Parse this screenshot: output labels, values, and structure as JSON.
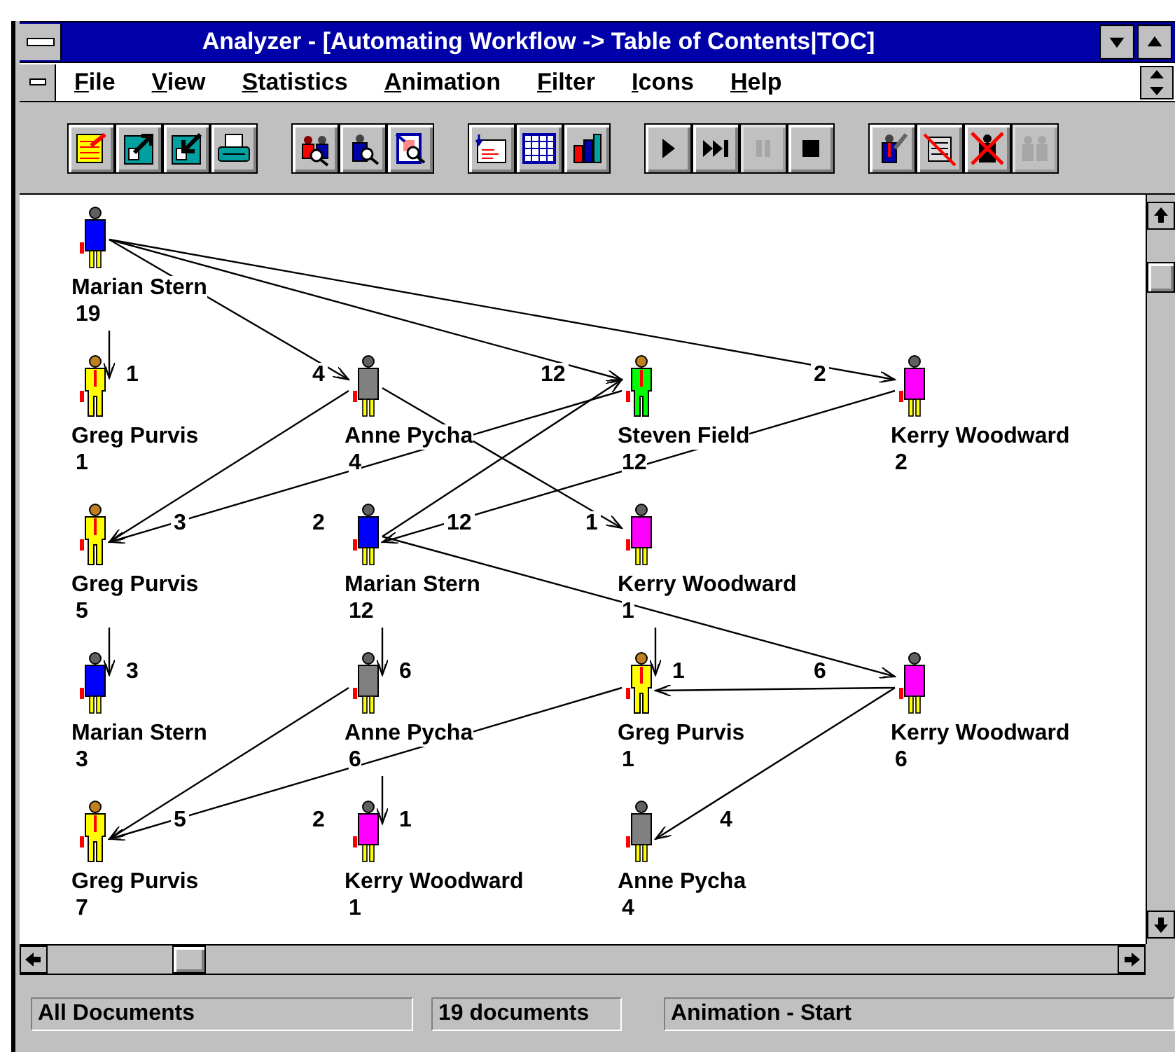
{
  "window": {
    "title": "Analyzer - [Automating Workflow -> Table of Contents|TOC]"
  },
  "menu": [
    "File",
    "View",
    "Statistics",
    "Animation",
    "Filter",
    "Icons",
    "Help"
  ],
  "toolbar": [
    [
      {
        "kind": "notepad",
        "disabled": false
      },
      {
        "kind": "export",
        "disabled": false
      },
      {
        "kind": "import",
        "disabled": false
      },
      {
        "kind": "printer",
        "disabled": false
      }
    ],
    [
      {
        "kind": "people-search",
        "disabled": false
      },
      {
        "kind": "person-search",
        "disabled": false
      },
      {
        "kind": "document-search",
        "disabled": false
      }
    ],
    [
      {
        "kind": "report",
        "disabled": false
      },
      {
        "kind": "grid",
        "disabled": false
      },
      {
        "kind": "bar-chart",
        "disabled": false
      }
    ],
    [
      {
        "kind": "play",
        "disabled": false
      },
      {
        "kind": "skip",
        "disabled": false
      },
      {
        "kind": "pause",
        "disabled": true
      },
      {
        "kind": "stop",
        "disabled": false
      }
    ],
    [
      {
        "kind": "person-edit",
        "disabled": false
      },
      {
        "kind": "paper-crossed",
        "disabled": false
      },
      {
        "kind": "person-crossed",
        "disabled": false
      },
      {
        "kind": "people",
        "disabled": true
      }
    ]
  ],
  "graph": {
    "levels": [
      {
        "nodes": [
          {
            "name": "Marian Stern",
            "count": "19",
            "kind": "female",
            "color": "#0000ff"
          }
        ]
      },
      {
        "nodes": [
          {
            "name": "Greg Purvis",
            "count": "1",
            "kind": "male",
            "color": "#ffff00",
            "labels": [
              {
                "text": "1",
                "kind": "right"
              }
            ]
          },
          {
            "name": "Anne Pycha",
            "count": "4",
            "kind": "female",
            "color": "#808080",
            "labels": [
              {
                "text": "4",
                "kind": "left"
              }
            ]
          },
          {
            "name": "Steven Field",
            "count": "12",
            "kind": "male",
            "color": "#00ff00",
            "labels": [
              {
                "text": "12",
                "kind": "far-left"
              }
            ]
          },
          {
            "name": "Kerry Woodward",
            "count": "2",
            "kind": "female",
            "color": "#ff00ff",
            "labels": [
              {
                "text": "2",
                "kind": "far-left"
              }
            ]
          }
        ]
      },
      {
        "nodes": [
          {
            "name": "Greg Purvis",
            "count": "5",
            "kind": "male",
            "color": "#ffff00",
            "labels": [
              {
                "text": "3",
                "kind": "far-right"
              }
            ]
          },
          {
            "name": "Marian Stern",
            "count": "12",
            "kind": "female",
            "color": "#0000ff",
            "labels": [
              {
                "text": "2",
                "kind": "left"
              },
              {
                "text": "12",
                "kind": "far-right"
              }
            ]
          },
          {
            "name": "Kerry Woodward",
            "count": "1",
            "kind": "female",
            "color": "#ff00ff",
            "labels": [
              {
                "text": "1",
                "kind": "left"
              }
            ]
          }
        ]
      },
      {
        "nodes": [
          {
            "name": "Marian Stern",
            "count": "3",
            "kind": "female",
            "color": "#0000ff",
            "labels": [
              {
                "text": "3",
                "kind": "right"
              }
            ]
          },
          {
            "name": "Anne Pycha",
            "count": "6",
            "kind": "female",
            "color": "#808080",
            "labels": [
              {
                "text": "6",
                "kind": "right"
              }
            ]
          },
          {
            "name": "Greg Purvis",
            "count": "1",
            "kind": "male",
            "color": "#ffff00",
            "labels": [
              {
                "text": "1",
                "kind": "right"
              }
            ]
          },
          {
            "name": "Kerry Woodward",
            "count": "6",
            "kind": "female",
            "color": "#ff00ff",
            "labels": [
              {
                "text": "6",
                "kind": "far-left"
              }
            ]
          }
        ]
      },
      {
        "nodes": [
          {
            "name": "Greg Purvis",
            "count": "7",
            "kind": "male",
            "color": "#ffff00",
            "labels": [
              {
                "text": "5",
                "kind": "far-right"
              }
            ]
          },
          {
            "name": "Kerry Woodward",
            "count": "1",
            "kind": "female",
            "color": "#ff00ff",
            "labels": [
              {
                "text": "2",
                "kind": "left"
              },
              {
                "text": "1",
                "kind": "right"
              }
            ]
          },
          {
            "name": "Anne Pycha",
            "count": "4",
            "kind": "female",
            "color": "#808080",
            "labels": [
              {
                "text": "4",
                "kind": "far-right"
              }
            ]
          }
        ]
      }
    ]
  },
  "status_bar": [
    "All Documents",
    "19 documents",
    "Animation - Start"
  ]
}
